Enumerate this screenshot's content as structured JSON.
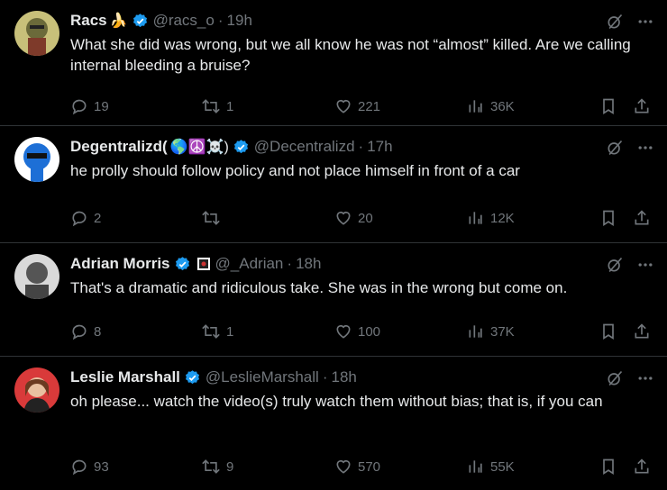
{
  "tweets": [
    {
      "name": "Racs",
      "name_emoji": "🍌",
      "handle": "@racs_o",
      "time": "19h",
      "text": "What she did was wrong, but we all know he was not “almost” killed. Are we calling internal bleeding a bruise?",
      "replies": "19",
      "reposts": "1",
      "likes": "221",
      "views": "36K"
    },
    {
      "name": "Degentralizd(",
      "name_emoji": "🌎☮️☠️)",
      "handle": "@Decentralizd",
      "time": "17h",
      "text": "he prolly should follow policy and not place himself in front of a car",
      "replies": "2",
      "reposts": "",
      "likes": "20",
      "views": "12K"
    },
    {
      "name": "Adrian Morris",
      "name_emoji": "",
      "handle": "@_Adrian",
      "time": "18h",
      "text": "That's a dramatic and ridiculous take. She was in the wrong but come on.",
      "replies": "8",
      "reposts": "1",
      "likes": "100",
      "views": "37K"
    },
    {
      "name": "Leslie Marshall",
      "name_emoji": "",
      "handle": "@LeslieMarshall",
      "time": "18h",
      "text": "oh please... watch the video(s) truly watch them without bias; that is, if you can",
      "replies": "93",
      "reposts": "9",
      "likes": "570",
      "views": "55K"
    }
  ],
  "colors": {
    "background": "#000000",
    "text": "#e7e9ea",
    "muted": "#71767b",
    "verified": "#1d9bf0",
    "divider": "#2f3336"
  },
  "icons": [
    "reply-icon",
    "repost-icon",
    "like-icon",
    "views-icon",
    "bookmark-icon",
    "share-icon",
    "grok-icon",
    "more-icon",
    "verified-icon"
  ]
}
